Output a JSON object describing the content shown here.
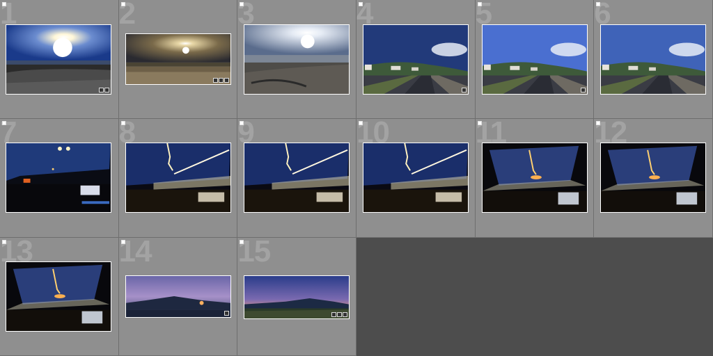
{
  "grid": {
    "background": "#4d4d4d",
    "cell_background": "#8f8f8f",
    "cells": [
      {
        "number": "1",
        "scene": "sunset-beach",
        "badges": [
          "metadata-icon",
          "edit-icon"
        ]
      },
      {
        "number": "2",
        "scene": "dusk-sea",
        "badges": [
          "metadata-icon",
          "crop-icon",
          "edit-icon"
        ]
      },
      {
        "number": "3",
        "scene": "bright-beach",
        "badges": []
      },
      {
        "number": "4",
        "scene": "coast-road-dark",
        "badges": [
          "edit-icon"
        ]
      },
      {
        "number": "5",
        "scene": "coast-road-blue",
        "badges": [
          "edit-icon"
        ]
      },
      {
        "number": "6",
        "scene": "coast-road-wide",
        "badges": []
      },
      {
        "number": "7",
        "scene": "car-night",
        "badges": []
      },
      {
        "number": "8",
        "scene": "light-streak",
        "badges": []
      },
      {
        "number": "9",
        "scene": "light-streak",
        "badges": []
      },
      {
        "number": "10",
        "scene": "light-streak",
        "badges": []
      },
      {
        "number": "11",
        "scene": "windshield",
        "badges": []
      },
      {
        "number": "12",
        "scene": "windshield",
        "badges": []
      },
      {
        "number": "13",
        "scene": "windshield-big",
        "badges": []
      },
      {
        "number": "14",
        "scene": "purple-coast",
        "badges": [
          "edit-icon"
        ]
      },
      {
        "number": "15",
        "scene": "blue-coast",
        "badges": [
          "metadata-icon",
          "crop-icon",
          "edit-icon"
        ]
      }
    ]
  }
}
